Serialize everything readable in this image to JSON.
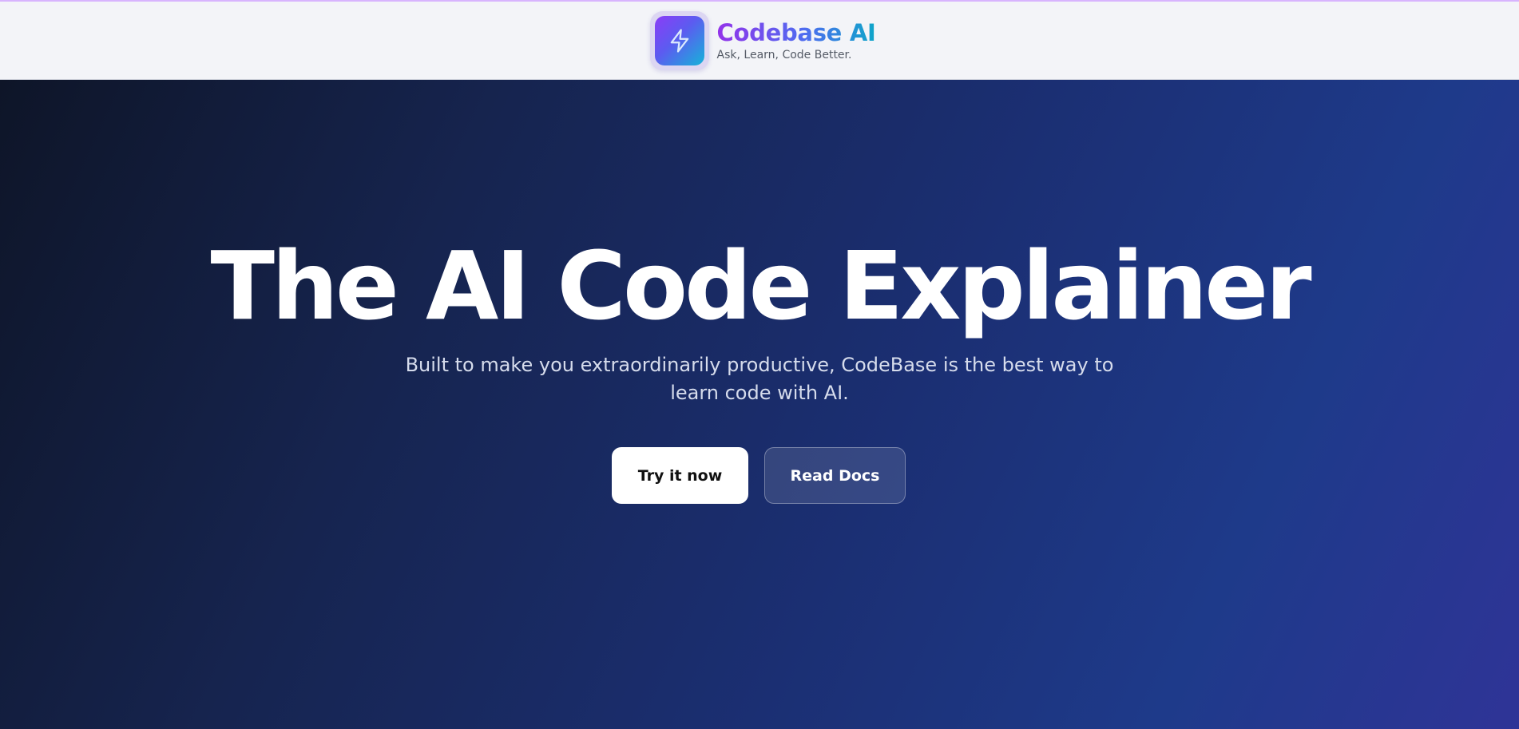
{
  "brand": {
    "name": "Codebase AI",
    "tagline": "Ask, Learn, Code Better.",
    "logo_icon": "lightning-bolt-icon"
  },
  "hero": {
    "title": "The AI Code Explainer",
    "subtitle": "Built to make you extraordinarily productive, CodeBase is the best way to learn code with AI."
  },
  "actions": {
    "primary_label": "Try it now",
    "secondary_label": "Read Docs"
  },
  "colors": {
    "brand_gradient_start": "#9333ea",
    "brand_gradient_end": "#0ea5c9",
    "hero_background": "#1e3a8a",
    "header_background": "#f3f4f8",
    "primary_button": "#ffffff"
  }
}
